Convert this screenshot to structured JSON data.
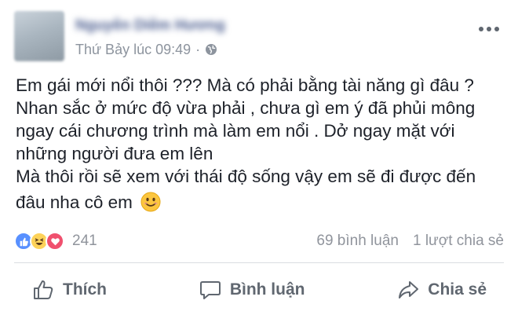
{
  "header": {
    "author_name": "Nguyễn Diễm Hương",
    "timestamp": "Thứ Bảy lúc 09:49",
    "separator": "·"
  },
  "post": {
    "lines": [
      "Em gái mới nổi thôi ??? Mà có phải bằng tài năng gì đâu ?",
      "Nhan sắc ở mức độ vừa phải , chưa gì em ý đã phủi mông",
      "ngay cái chương trình mà làm em nổi . Dở ngay mặt với",
      "những người đưa em lên",
      "Mà thôi rồi sẽ xem với thái độ sống vậy em sẽ đi được đến",
      "đâu nha cô em"
    ]
  },
  "stats": {
    "reaction_count": "241",
    "comments": "69 bình luận",
    "shares": "1 lượt chia sẻ"
  },
  "actions": {
    "like": "Thích",
    "comment": "Bình luận",
    "share": "Chia sẻ"
  },
  "colors": {
    "like_blue": "#5890ff",
    "haha_yellow": "#fdd259",
    "love_red": "#f0506e",
    "muted": "#90949c",
    "action_gray": "#606770"
  },
  "icons": [
    "globe-icon",
    "more-options-icon",
    "like-reaction-icon",
    "haha-reaction-icon",
    "love-reaction-icon",
    "thumbs-up-icon",
    "comment-icon",
    "share-icon",
    "smiley-emoji"
  ]
}
